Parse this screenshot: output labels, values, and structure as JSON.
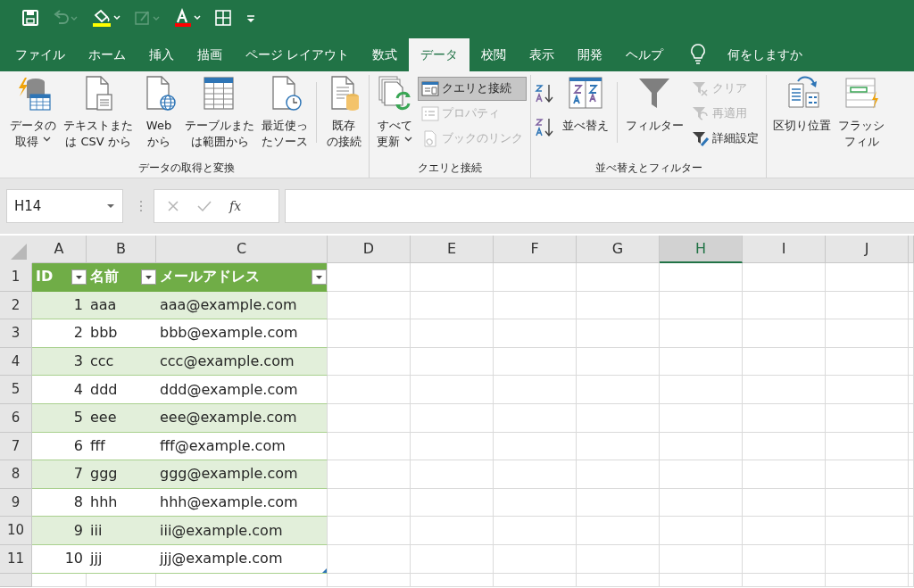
{
  "quick_access": [
    {
      "kind": "save",
      "disabled": false
    },
    {
      "kind": "undo",
      "disabled": true
    },
    {
      "kind": "fill-color",
      "disabled": false
    },
    {
      "kind": "form",
      "disabled": true
    },
    {
      "kind": "font-color",
      "disabled": false
    },
    {
      "kind": "borders",
      "disabled": false
    },
    {
      "kind": "customize",
      "disabled": false
    }
  ],
  "tabs": [
    {
      "label": "ファイル",
      "selected": false
    },
    {
      "label": "ホーム",
      "selected": false
    },
    {
      "label": "挿入",
      "selected": false
    },
    {
      "label": "描画",
      "selected": false
    },
    {
      "label": "ページ レイアウト",
      "selected": false
    },
    {
      "label": "数式",
      "selected": false
    },
    {
      "label": "データ",
      "selected": true
    },
    {
      "label": "校閲",
      "selected": false
    },
    {
      "label": "表示",
      "selected": false
    },
    {
      "label": "開発",
      "selected": false
    },
    {
      "label": "ヘルプ",
      "selected": false
    }
  ],
  "tell_me": "何をしますか",
  "ribbon_groups": [
    {
      "label": "データの取得と変換",
      "items": [
        {
          "kind": "large",
          "lines": [
            "データの",
            "取得"
          ],
          "dropdown": true
        },
        {
          "kind": "large",
          "lines": [
            "テキストまた",
            "は CSV から"
          ]
        },
        {
          "kind": "large",
          "lines": [
            "Web",
            "から"
          ]
        },
        {
          "kind": "large",
          "lines": [
            "テーブルまた",
            "は範囲から"
          ]
        },
        {
          "kind": "large",
          "lines": [
            "最近使っ",
            "たソース"
          ]
        },
        {
          "kind": "large",
          "lines": [
            "既存",
            "の接続"
          ],
          "divider_before": true
        }
      ]
    },
    {
      "label": "クエリと接続",
      "items": [
        {
          "kind": "large",
          "lines": [
            "すべて",
            "更新"
          ],
          "dropdown": true
        },
        {
          "kind": "stack",
          "entries": [
            {
              "label": "クエリと接続",
              "selected": true,
              "disabled": false
            },
            {
              "label": "プロパティ",
              "selected": false,
              "disabled": true
            },
            {
              "label": "ブックのリンク",
              "selected": false,
              "disabled": true
            }
          ]
        }
      ]
    },
    {
      "label": "並べ替えとフィルター",
      "items": [
        {
          "kind": "sort-pair"
        },
        {
          "kind": "large",
          "lines": [
            "並べ替え"
          ]
        },
        {
          "kind": "large",
          "lines": [
            "フィルター"
          ],
          "divider_before": true
        },
        {
          "kind": "stack",
          "entries": [
            {
              "label": "クリア",
              "selected": false,
              "disabled": true
            },
            {
              "label": "再適用",
              "selected": false,
              "disabled": true
            },
            {
              "label": "詳細設定",
              "selected": false,
              "disabled": false
            }
          ]
        }
      ]
    },
    {
      "items": [
        {
          "kind": "large",
          "lines": [
            "区切り位置"
          ]
        },
        {
          "kind": "large",
          "lines": [
            "フラッシ",
            "フィル"
          ]
        }
      ]
    }
  ],
  "name_box": "H14",
  "function_label": "fx",
  "columns": [
    {
      "label": "A",
      "selected": false
    },
    {
      "label": "B",
      "selected": false
    },
    {
      "label": "C",
      "selected": false
    },
    {
      "label": "D",
      "selected": false
    },
    {
      "label": "E",
      "selected": false
    },
    {
      "label": "F",
      "selected": false
    },
    {
      "label": "G",
      "selected": false
    },
    {
      "label": "H",
      "selected": true
    },
    {
      "label": "I",
      "selected": false
    },
    {
      "label": "J",
      "selected": false
    }
  ],
  "row_numbers": [
    "1",
    "2",
    "3",
    "4",
    "5",
    "6",
    "7",
    "8",
    "9",
    "10",
    "11"
  ],
  "table": {
    "headers": [
      "ID",
      "名前",
      "メールアドレス"
    ],
    "rows": [
      [
        "1",
        "aaa",
        "aaa@example.com"
      ],
      [
        "2",
        "bbb",
        "bbb@example.com"
      ],
      [
        "3",
        "ccc",
        "ccc@example.com"
      ],
      [
        "4",
        "ddd",
        "ddd@example.com"
      ],
      [
        "5",
        "eee",
        "eee@example.com"
      ],
      [
        "6",
        "fff",
        "fff@example.com"
      ],
      [
        "7",
        "ggg",
        "ggg@example.com"
      ],
      [
        "8",
        "hhh",
        "hhh@example.com"
      ],
      [
        "9",
        "iii",
        "iii@example.com"
      ],
      [
        "10",
        "jjj",
        "jjj@example.com"
      ]
    ]
  }
}
